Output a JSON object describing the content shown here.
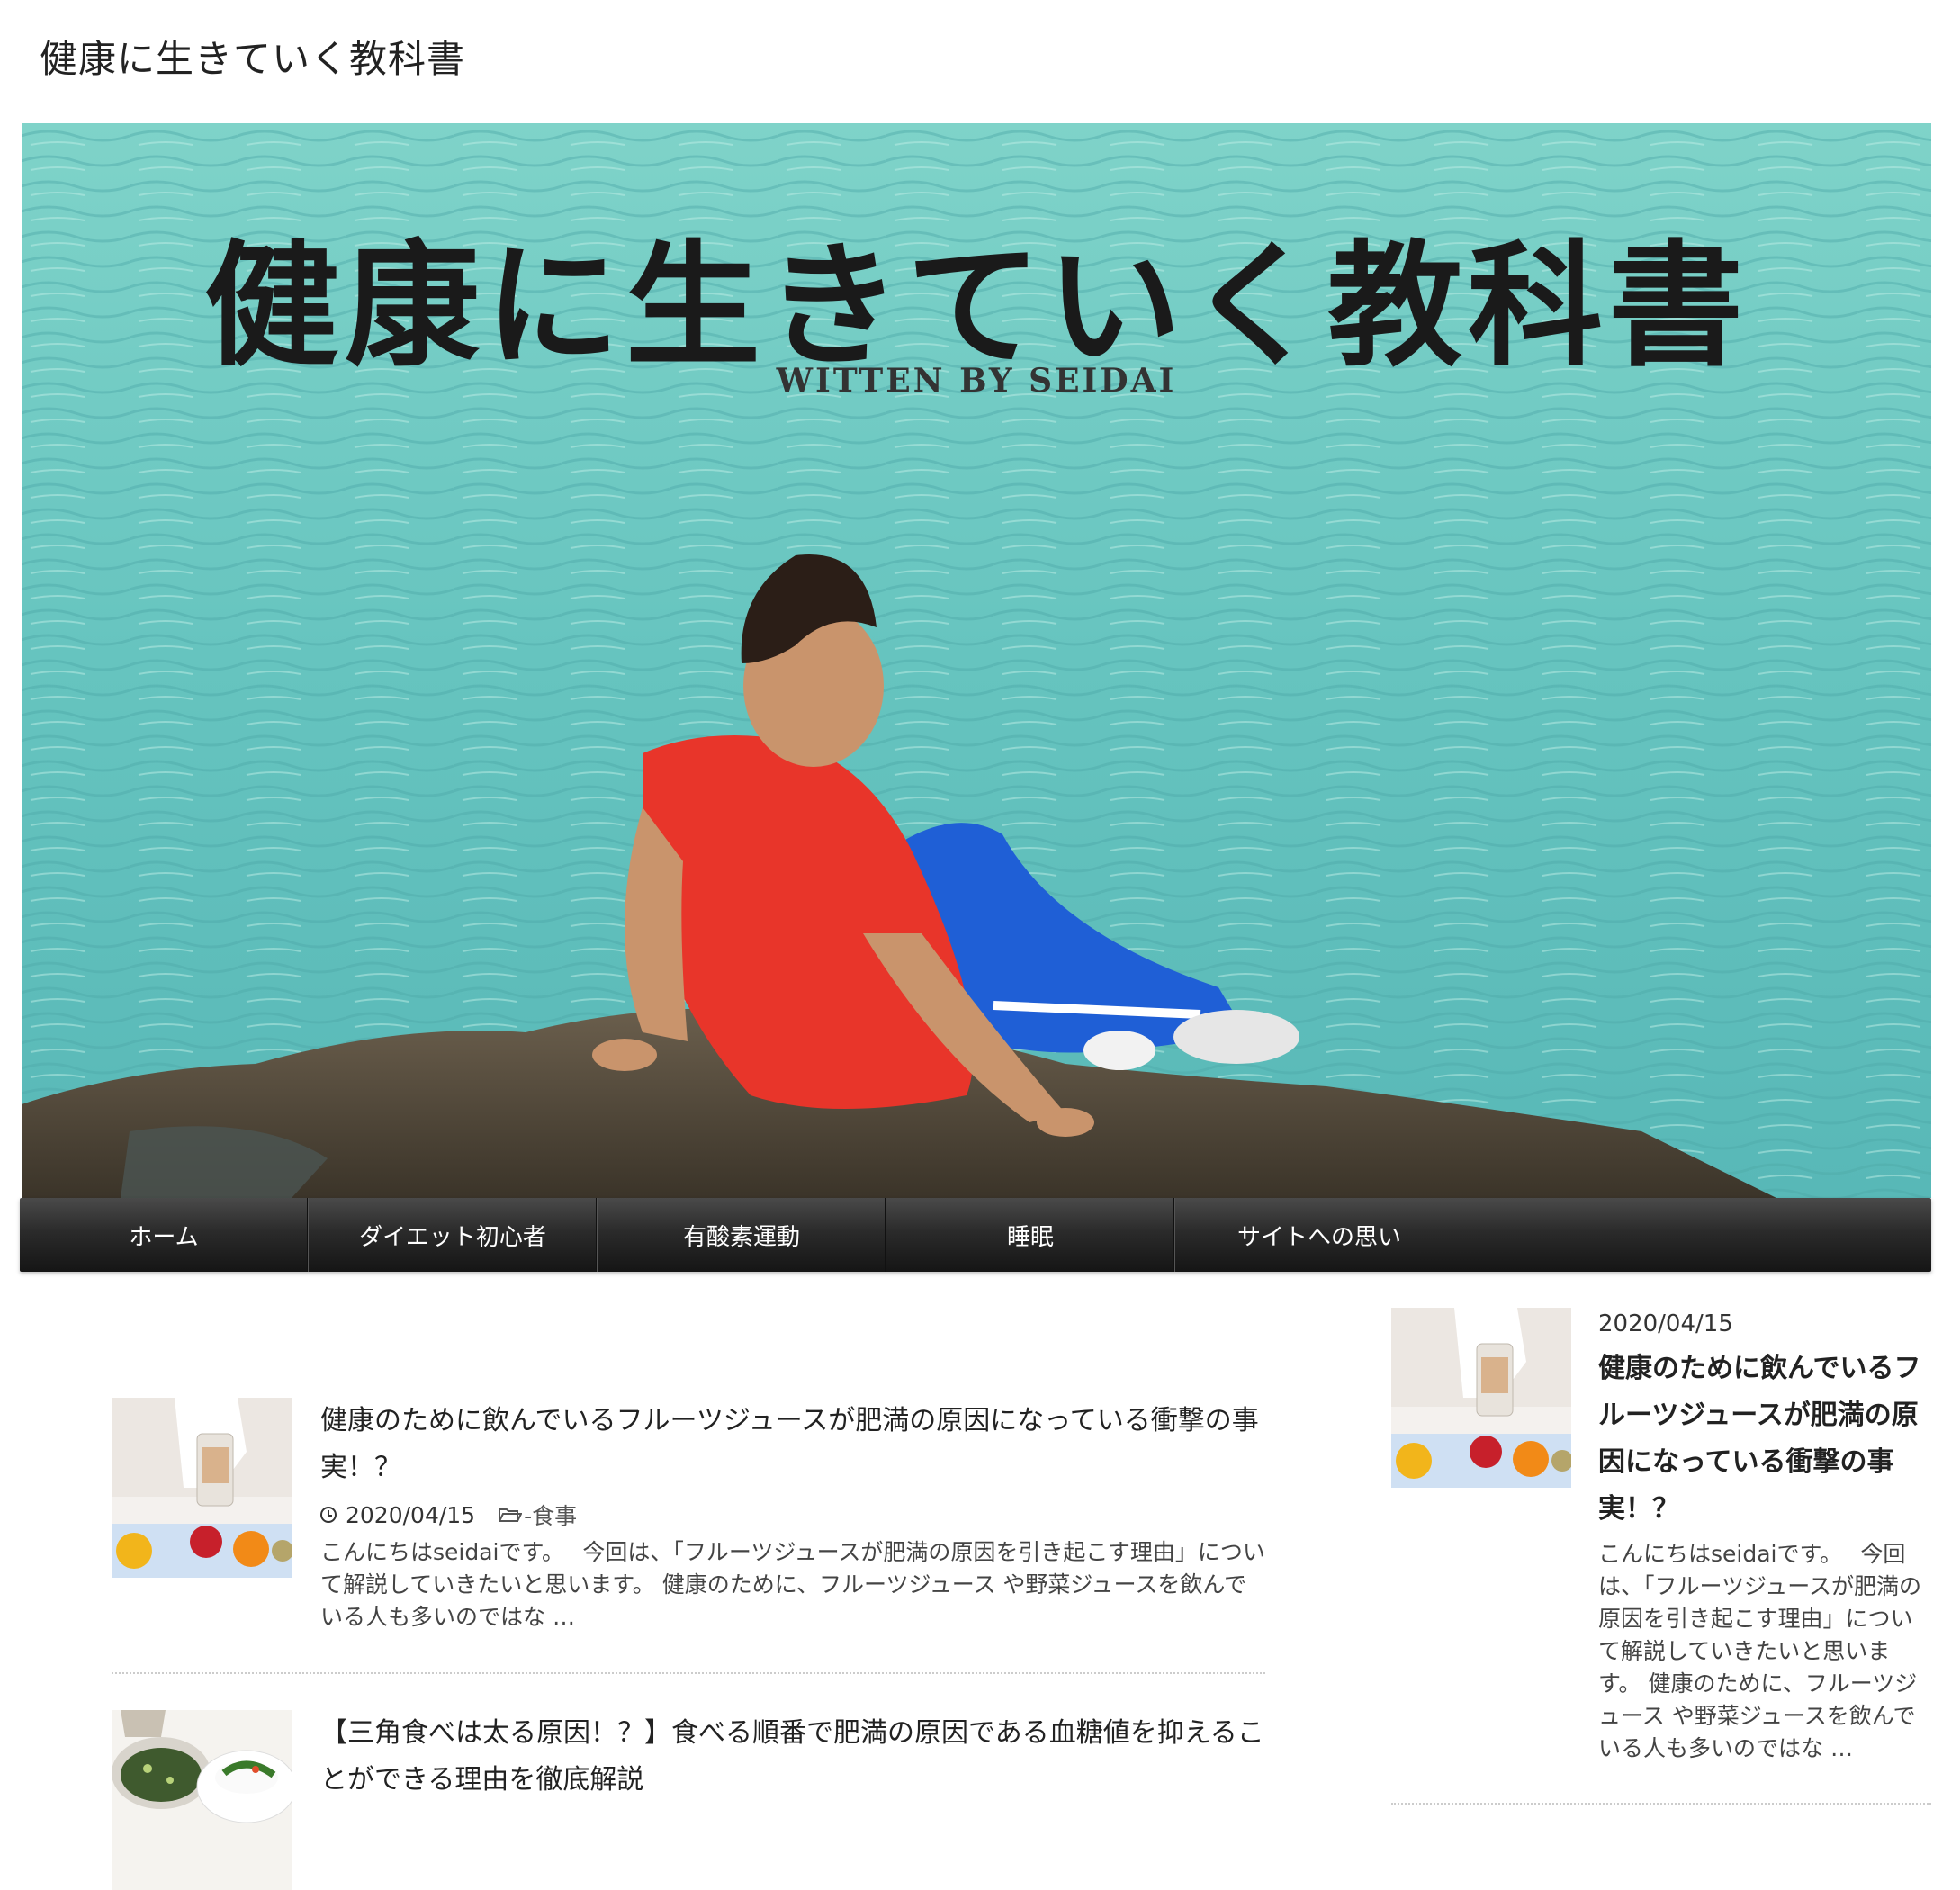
{
  "site": {
    "title": "健康に生きていく教科書"
  },
  "hero": {
    "logo_text": "健康に生きていく教科書",
    "byline": "WITTEN BY SEIDAI"
  },
  "nav": {
    "items": [
      {
        "label": "ホーム"
      },
      {
        "label": "ダイエット初心者"
      },
      {
        "label": "有酸素運動"
      },
      {
        "label": "睡眠"
      },
      {
        "label": "サイトへの思い"
      }
    ]
  },
  "posts": [
    {
      "title": "健康のために飲んでいるフルーツジュースが肥満の原因になっている衝撃の事実！？",
      "date": "2020/04/15",
      "category": "-食事",
      "excerpt": "こんにちはseidaiです。　 今回は、「フルーツジュースが肥満の原因を引き起こす理由」について解説していきたいと思います。 健康のために、フルーツジュース や野菜ジュースを飲んでいる人も多いのではな …"
    },
    {
      "title": "【三角食べは太る原因！？】食べる順番で肥満の原因である血糖値を抑えることができる理由を徹底解説"
    }
  ],
  "sidebar": {
    "date": "2020/04/15",
    "title": "健康のために飲んでいるフルーツジュースが肥満の原因になっている衝撃の事実！？",
    "excerpt": "こんにちはseidaiです。　 今回は、「フルーツジュースが肥満の原因を引き起こす理由」について解説していきたいと思います。 健康のために、フルーツジュース や野菜ジュースを飲んでいる人も多いのではな …"
  },
  "colors": {
    "sea": "#6ec9c0",
    "shirt": "#e8352a",
    "pants": "#1f5fd6",
    "nav_bg": "#2b2b2b"
  }
}
